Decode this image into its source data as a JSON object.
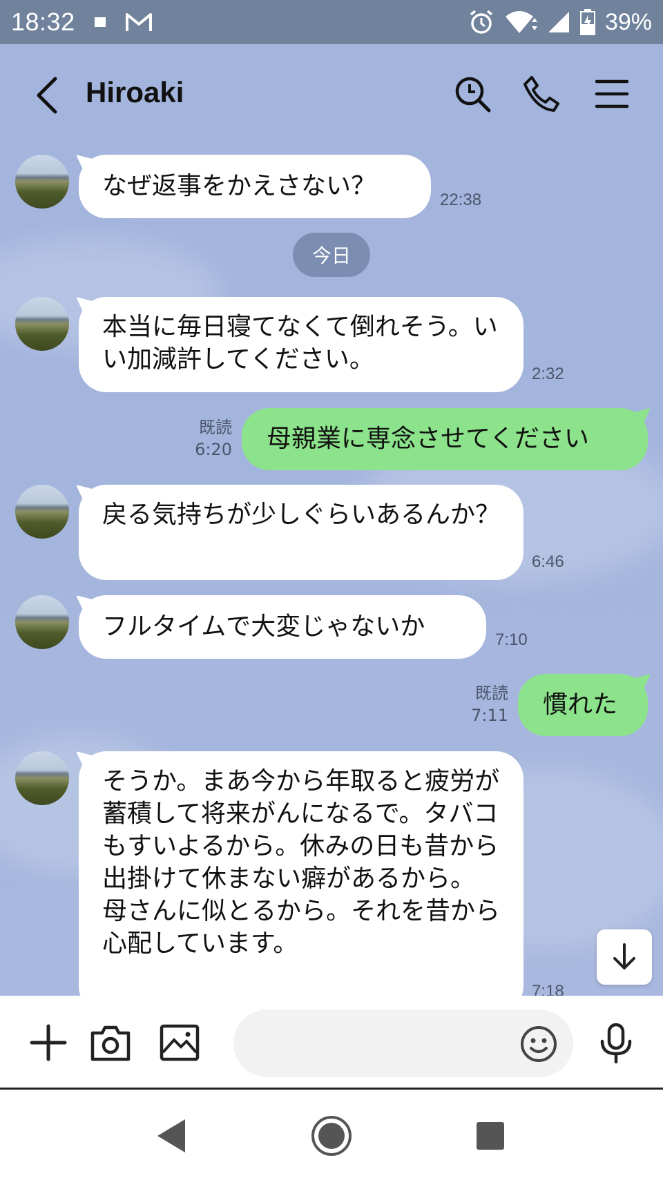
{
  "status_bar": {
    "time": "18:32",
    "battery": "39%",
    "icons": [
      "notification-square-icon",
      "gmail-icon",
      "alarm-icon",
      "wifi-icon",
      "signal-icon",
      "battery-icon"
    ]
  },
  "header": {
    "title": "Hiroaki",
    "icons": [
      "back-icon",
      "search-icon",
      "phone-icon",
      "menu-icon"
    ]
  },
  "messages": [
    {
      "side": "in",
      "text": "なぜ返事をかえさない？",
      "time": "22:38"
    },
    {
      "type": "date",
      "label": "今日"
    },
    {
      "side": "in",
      "text": "本当に毎日寝てなくて倒れそう。いい加減許してください。",
      "time": "2:32"
    },
    {
      "side": "out",
      "text": "母親業に専念させてください",
      "read": "既読",
      "time": "6:20"
    },
    {
      "side": "in",
      "text": "戻る気持ちが少しぐらいあるんか？",
      "time": "6:46"
    },
    {
      "side": "in",
      "text": "フルタイムで大変じゃないか",
      "time": "7:10"
    },
    {
      "side": "out",
      "text": "慣れた",
      "read": "既読",
      "time": "7:11"
    },
    {
      "side": "in",
      "text": "そうか。まあ今から年取ると疲労が蓄積して将来がんになるで。タバコもすいよるから。休みの日も昔から出掛けて休まない癖があるから。\n母さんに似とるから。それを昔から心配しています。",
      "time": "7:18"
    }
  ],
  "input": {
    "value": "",
    "placeholder": ""
  },
  "colors": {
    "chat_background": "#a3b4dd",
    "status_bar": "#71829c",
    "outgoing_bubble": "#8ce38b",
    "incoming_bubble": "#ffffff",
    "date_pill": "#7b8db0"
  }
}
